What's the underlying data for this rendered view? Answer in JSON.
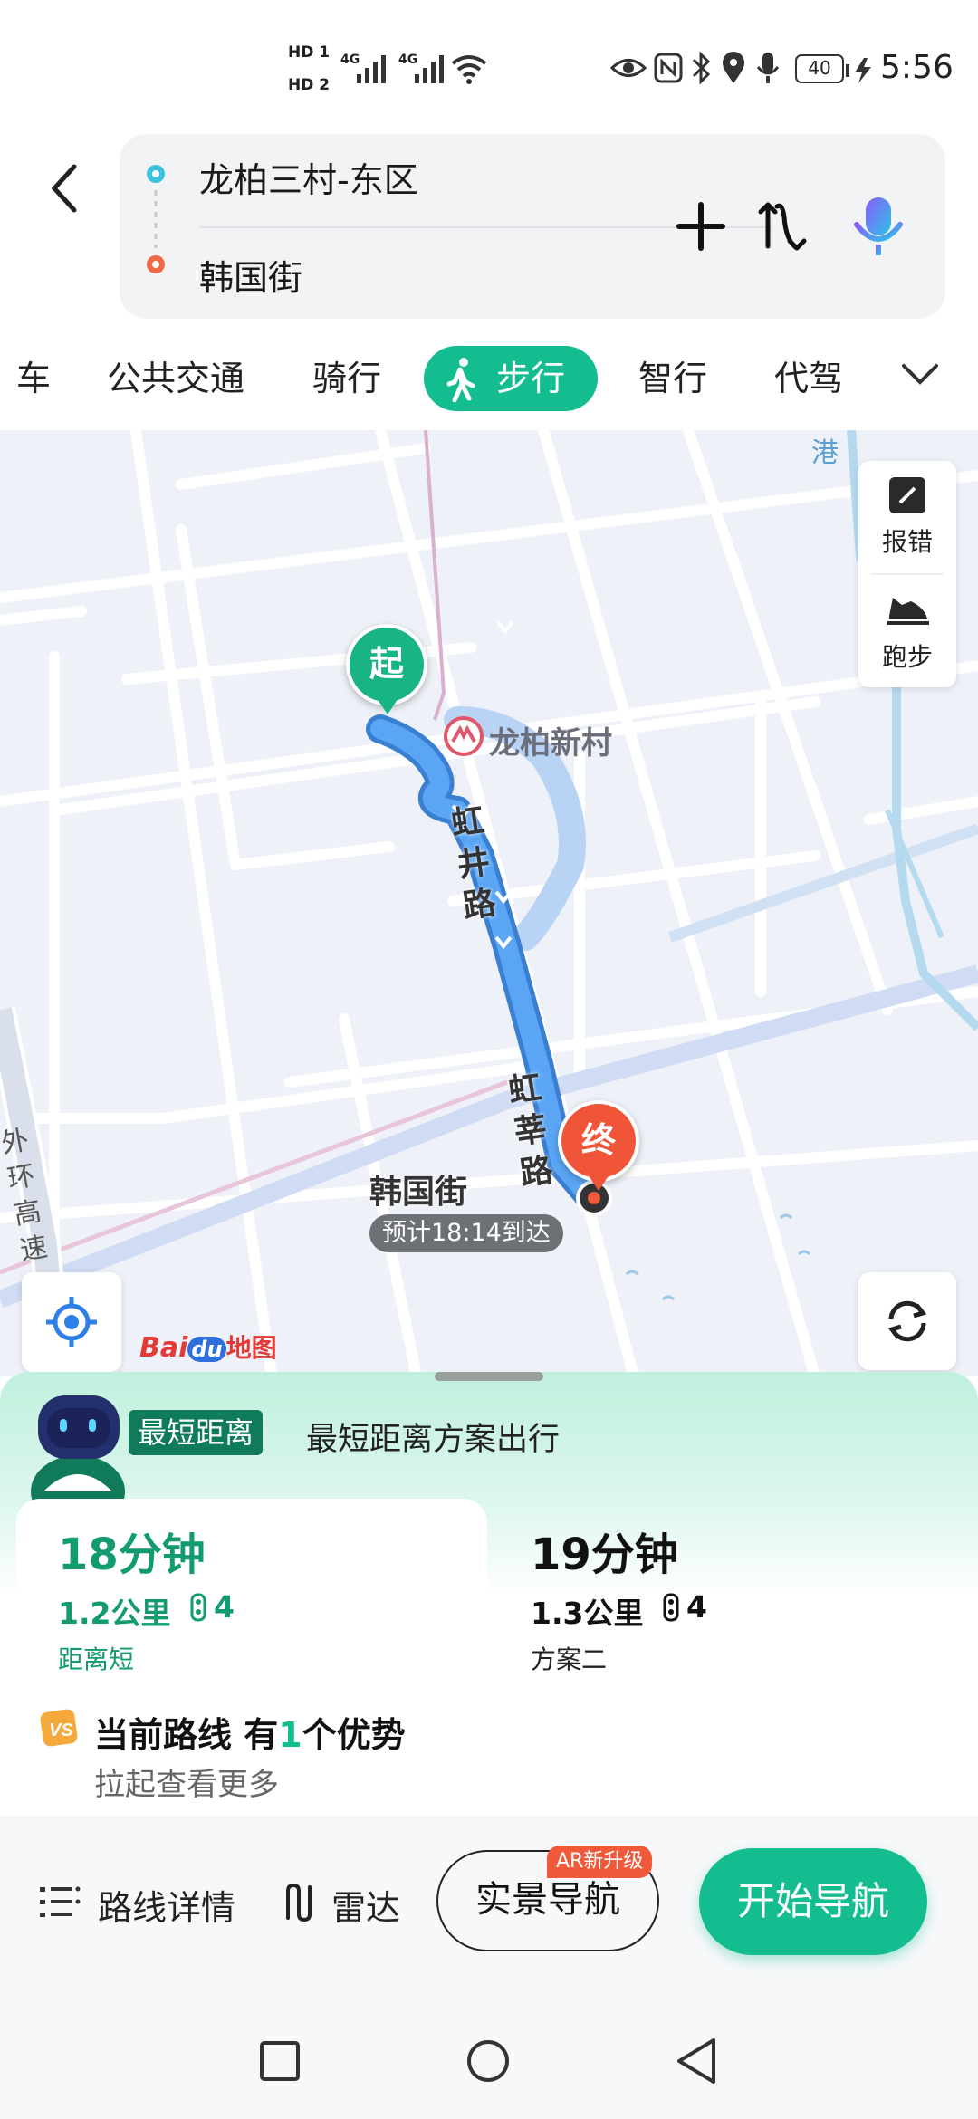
{
  "status_bar": {
    "sim1": "HD 1",
    "sim2": "HD 2",
    "net1": "4G",
    "net2": "4G",
    "battery": "40",
    "time": "5:56"
  },
  "header": {
    "origin": "龙柏三村-东区",
    "destination": "韩国街"
  },
  "tabs": [
    {
      "label": "车"
    },
    {
      "label": "公共交通"
    },
    {
      "label": "骑行"
    },
    {
      "label": "步行"
    },
    {
      "label": "智行"
    },
    {
      "label": "代驾"
    }
  ],
  "map": {
    "start_marker": "起",
    "end_marker": "终",
    "metro_station": "龙柏新村",
    "road1": "虹井路",
    "road2": "虹莘路",
    "road3": "外环高速",
    "road4": "港",
    "dest_label": "韩国街",
    "eta": "预计18:14到达",
    "report_btn": "报错",
    "run_btn": "跑步",
    "logo_bai": "Bai",
    "logo_du": "du",
    "logo_map": "地图",
    "colors": {
      "route": "#3b8fe8",
      "start": "#19b486",
      "end": "#f0553a"
    }
  },
  "panel": {
    "badge": "最短距离",
    "tagline": "最短距离方案出行",
    "options": [
      {
        "time": "18分钟",
        "distance": "1.2公里",
        "lights": "4",
        "note": "距离短"
      },
      {
        "time": "19分钟",
        "distance": "1.3公里",
        "lights": "4",
        "note": "方案二"
      }
    ],
    "advantage_prefix": "当前路线 有",
    "advantage_count": "1",
    "advantage_suffix": "个优势",
    "advantage_sub": "拉起查看更多"
  },
  "actions": {
    "details": "路线详情",
    "radar": "雷达",
    "ar_nav": "实景导航",
    "ar_badge": "AR新升级",
    "start_nav": "开始导航"
  }
}
